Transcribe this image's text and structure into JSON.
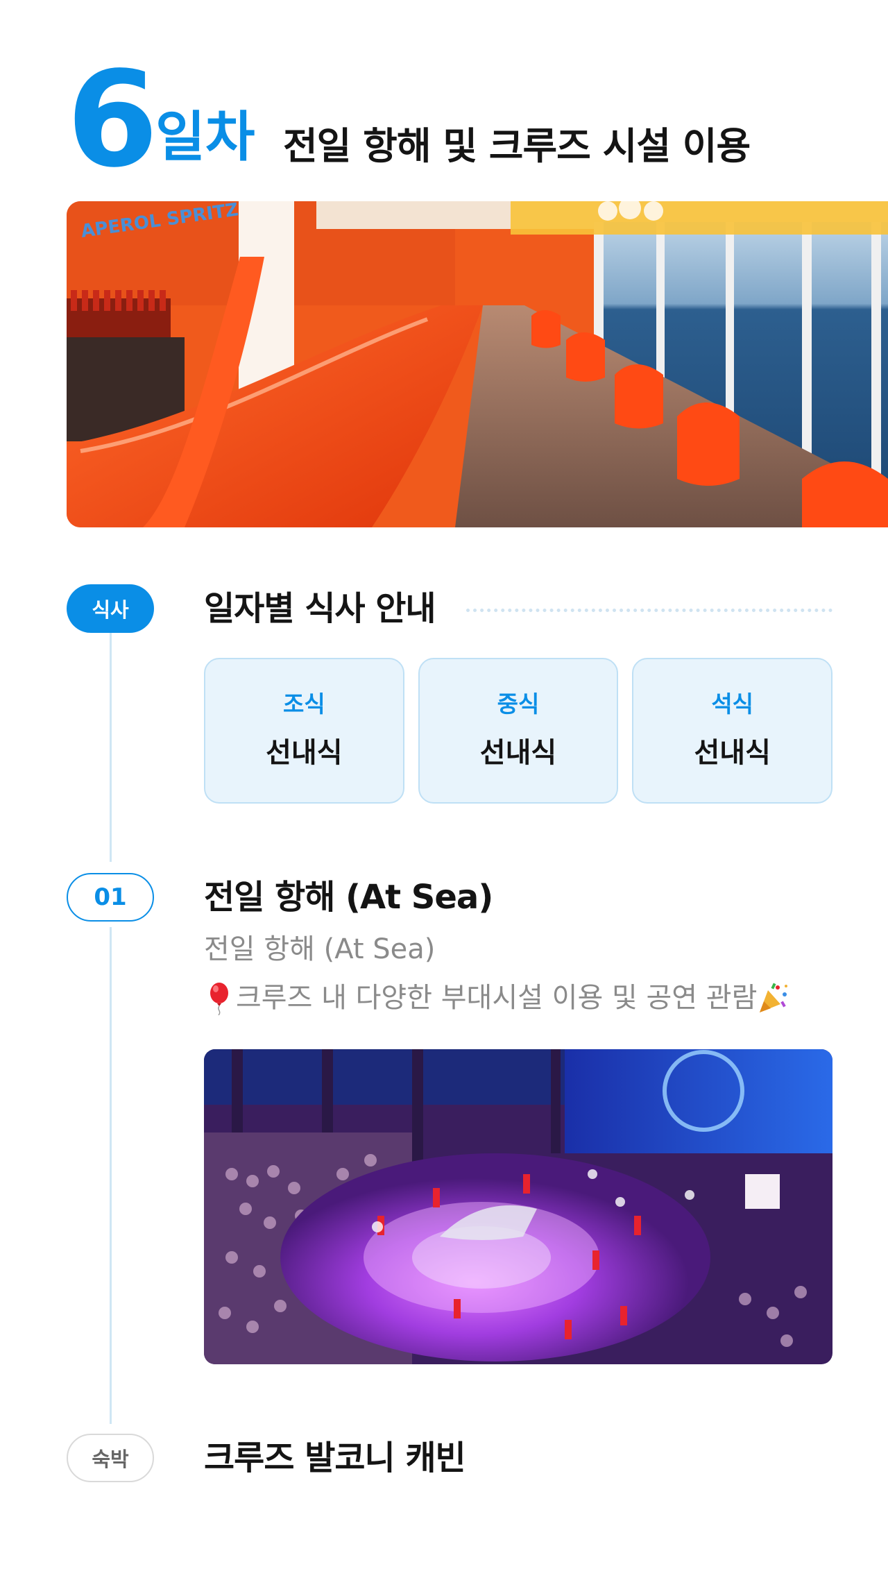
{
  "day": {
    "number": "6",
    "suffix": "일차",
    "title": "전일 항해 및 크루즈 시설 이용"
  },
  "hero_image": {
    "sign_text": "APEROL SPRITZ",
    "accent_color": "#ff4a14"
  },
  "meals": {
    "badge": "식사",
    "title": "일자별 식사 안내",
    "items": [
      {
        "label": "조식",
        "value": "선내식"
      },
      {
        "label": "중식",
        "value": "선내식"
      },
      {
        "label": "석식",
        "value": "선내식"
      }
    ]
  },
  "steps": [
    {
      "badge": "01",
      "title": "전일 항해 (At Sea)",
      "subtitle": "전일 항해 (At Sea)",
      "description": "크루즈 내 다양한 부대시설 이용 및 공연 관람",
      "leading_icon": "balloon-icon",
      "trailing_icon": "party-popper-icon"
    }
  ],
  "stay": {
    "badge": "숙박",
    "title": "크루즈 발코니 캐빈"
  },
  "colors": {
    "brand_blue": "#0a8ee6",
    "card_bg": "#e8f4fc",
    "card_border": "#bfe0f5",
    "muted_text": "#8a8a8a"
  }
}
